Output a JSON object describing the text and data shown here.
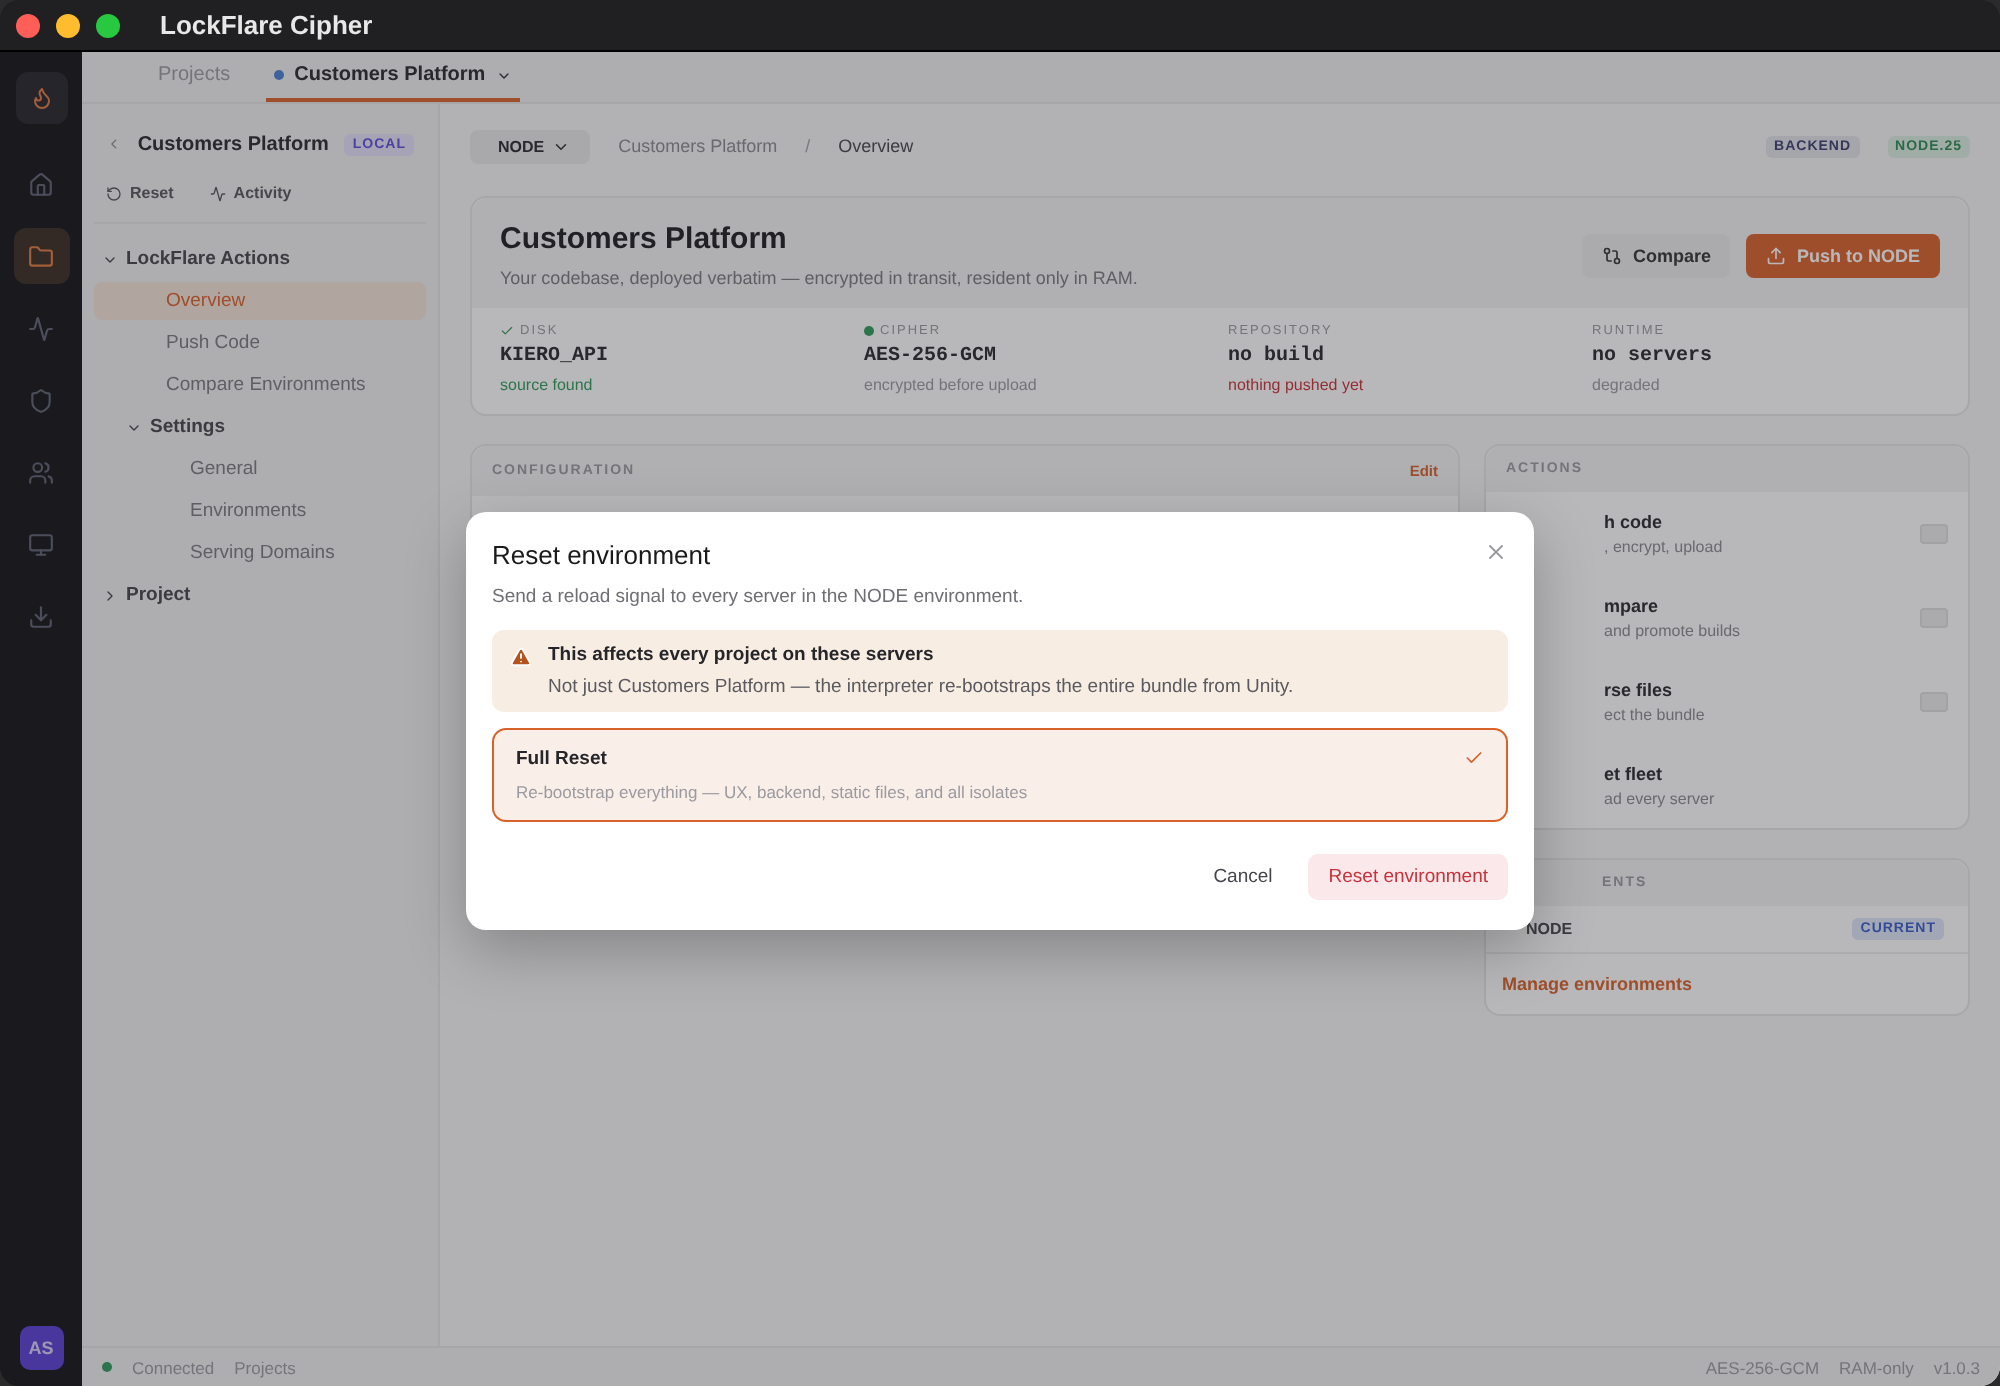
{
  "window": {
    "title": "LockFlare Cipher"
  },
  "rail": {
    "items": [
      {
        "selected": false
      },
      {
        "selected": true
      },
      {
        "selected": false
      },
      {
        "selected": false
      },
      {
        "selected": false
      },
      {
        "selected": false
      },
      {
        "selected": false
      }
    ],
    "avatar": "AS"
  },
  "top_tabs": [
    {
      "label": "Projects",
      "selected": false
    },
    {
      "label": "Customers Platform",
      "selected": true
    }
  ],
  "sidebar": {
    "title": "Customers Platform",
    "badge": "LOCAL",
    "actions": [
      "Reset",
      "Activity"
    ],
    "tree": [
      {
        "label": "LockFlare Actions",
        "expanded": true,
        "children": [
          {
            "label": "Overview",
            "selected": true
          },
          {
            "label": "Push Code",
            "selected": false
          },
          {
            "label": "Compare Environments",
            "selected": false
          },
          {
            "label": "Settings",
            "expanded": true,
            "children": [
              {
                "label": "General",
                "selected": false
              },
              {
                "label": "Environments",
                "selected": false
              },
              {
                "label": "Serving Domains",
                "selected": false
              }
            ]
          }
        ]
      },
      {
        "label": "Project",
        "expanded": false
      }
    ]
  },
  "header": {
    "environment": "NODE",
    "breadcrumbs": [
      "Customers Platform",
      "Overview"
    ],
    "separator": "/",
    "badges": [
      {
        "label": "BACKEND",
        "kind": "neutral"
      },
      {
        "label": "NODE.25",
        "kind": "success"
      }
    ]
  },
  "project": {
    "title": "Customers Platform",
    "subtitle": "Your codebase, deployed verbatim — encrypted in transit, resident only in RAM.",
    "compare": "Compare",
    "push": "Push to NODE"
  },
  "stats": [
    {
      "kind": "verified",
      "label": "DISK",
      "value": "KIERO_API",
      "note": "source found"
    },
    {
      "kind": "secured",
      "label": "CIPHER",
      "value": "AES-256-GCM",
      "note": "encrypted before upload"
    },
    {
      "kind": "missing",
      "label": "REPOSITORY",
      "value": "no build",
      "note": "nothing pushed yet"
    },
    {
      "kind": "idle",
      "label": "RUNTIME",
      "value": "no servers",
      "note": "degraded"
    }
  ],
  "configuration": {
    "title": "CONFIGURATION",
    "action": "Edit"
  },
  "actions": {
    "title": "ACTIONS",
    "items": [
      {
        "title": "h code",
        "description": ", encrypt, upload",
        "shortcut": true
      },
      {
        "title": "mpare",
        "description": "and promote builds",
        "shortcut": true
      },
      {
        "title": "rse files",
        "description": "ect the bundle",
        "shortcut": true
      },
      {
        "title": "et fleet",
        "description": "ad every server",
        "shortcut": false
      }
    ]
  },
  "environments": {
    "title": "ENTS",
    "items": [
      {
        "name": "NODE",
        "badge": "CURRENT"
      }
    ],
    "link": "Manage environments"
  },
  "status_bar": {
    "connected": true,
    "left": [
      "Connected",
      "Projects"
    ],
    "right": [
      "AES-256-GCM",
      "RAM-only",
      "v1.0.3"
    ]
  },
  "dialog": {
    "title": "Reset environment",
    "subtitle": "Send a reload signal to every server in the NODE environment.",
    "warning": {
      "title": "This affects every project on these servers",
      "text": "Not just Customers Platform — the interpreter re-bootstraps the entire bundle from Unity."
    },
    "options": [
      {
        "title": "Full Reset",
        "description": "Re-bootstrap everything — UX, backend, static files, and all isolates",
        "selected": true
      }
    ],
    "cancel": "Cancel",
    "confirm": "Reset environment"
  }
}
